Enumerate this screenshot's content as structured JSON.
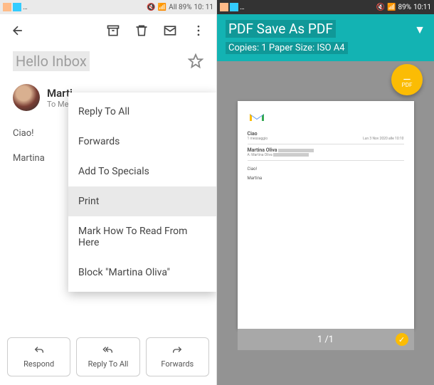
{
  "left": {
    "status": {
      "battery": "All 89%",
      "time": "10: 11"
    },
    "subject": "Hello Inbox",
    "sender": {
      "name": "Marti",
      "to": "To Me"
    },
    "body": {
      "greeting": "Ciao!",
      "text": "Martina"
    },
    "menu": {
      "reply_all": "Reply To All",
      "forwards": "Forwards",
      "specials": "Add To Specials",
      "print": "Print",
      "mark_read": "Mark How To Read From Here",
      "block": "Block \"Martina Oliva\""
    },
    "actions": {
      "respond": "Respond",
      "reply_all": "Reply To All",
      "forwards": "Forwards"
    }
  },
  "right": {
    "status": {
      "battery": "89%",
      "time": "10:11"
    },
    "title": "PDF Save As PDF",
    "subtitle": "Copies: 1 Paper Size: ISO A4",
    "fab": "PDF",
    "preview": {
      "subject": "Ciao",
      "msgcount": "1 messaggio",
      "from": "Martina Oliva",
      "to": "A: Martina Oliva",
      "date": "Lun 3 Nov 2020 alle 10:10",
      "greeting": "Ciao!",
      "body": "Martina"
    },
    "footer": "1 /1"
  }
}
